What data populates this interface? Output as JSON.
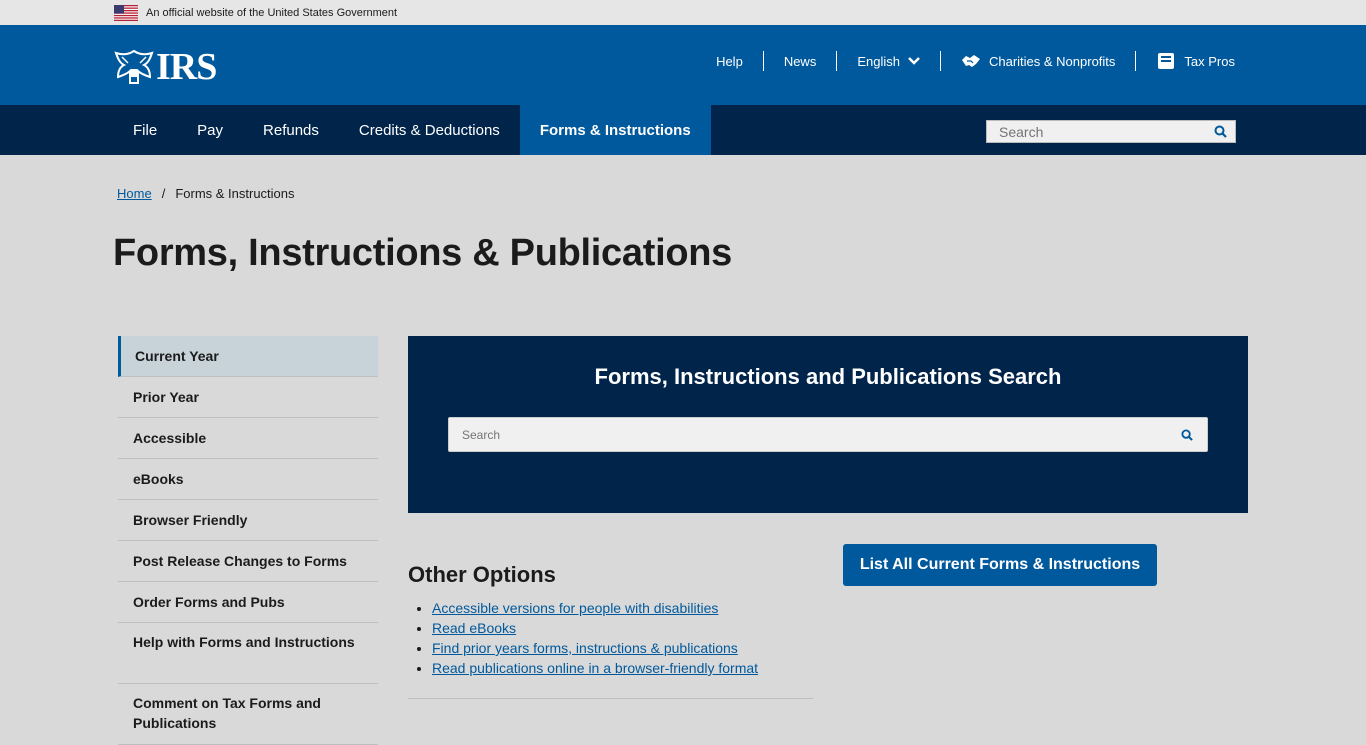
{
  "gov_banner": {
    "text": "An official website of the United States Government",
    "icon": "us-flag-icon"
  },
  "header": {
    "logo_text": "IRS",
    "utility_nav": [
      {
        "label": "Help"
      },
      {
        "label": "News"
      },
      {
        "label": "English",
        "icon": "chevron-down-icon"
      },
      {
        "label": "Charities & Nonprofits",
        "icon": "handshake-icon"
      },
      {
        "label": "Tax Pros",
        "icon": "book-icon"
      }
    ]
  },
  "main_nav": {
    "items": [
      {
        "label": "File"
      },
      {
        "label": "Pay"
      },
      {
        "label": "Refunds"
      },
      {
        "label": "Credits & Deductions"
      },
      {
        "label": "Forms & Instructions",
        "active": true
      }
    ],
    "search_placeholder": "Search"
  },
  "breadcrumb": {
    "home": "Home",
    "separator": "/",
    "current": "Forms & Instructions"
  },
  "page_title": "Forms, Instructions & Publications",
  "sidebar": {
    "items": [
      {
        "label": "Current Year",
        "active": true
      },
      {
        "label": "Prior Year"
      },
      {
        "label": "Accessible"
      },
      {
        "label": "eBooks"
      },
      {
        "label": "Browser Friendly"
      },
      {
        "label": "Post Release Changes to Forms"
      },
      {
        "label": "Order Forms and Pubs"
      },
      {
        "label": "Help with Forms and Instructions"
      },
      {
        "label": "Comment on Tax Forms and Publications"
      }
    ]
  },
  "search_panel": {
    "title": "Forms, Instructions and Publications Search",
    "placeholder": "Search"
  },
  "other_options": {
    "title": "Other Options",
    "links": [
      "Accessible versions for people with disabilities",
      "Read eBooks",
      "Find prior years forms, instructions & publications",
      "Read publications online in a browser-friendly format"
    ]
  },
  "list_button": {
    "label": "List All Current Forms & Instructions"
  },
  "colors": {
    "header_blue": "#00599c",
    "nav_navy": "#00244a",
    "page_bg": "#d9d9d9",
    "link": "#00599c"
  }
}
